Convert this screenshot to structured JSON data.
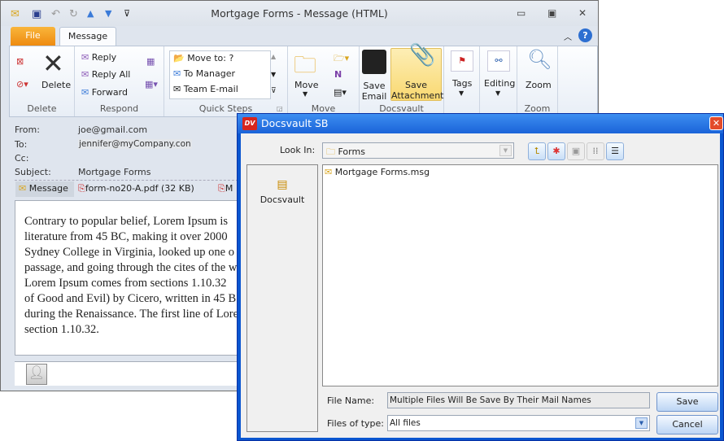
{
  "window": {
    "title": "Mortgage Forms  -  Message (HTML)"
  },
  "qat": {
    "icons": [
      "mail-icon",
      "save-icon",
      "undo-icon",
      "redo-icon",
      "up-arrow-icon",
      "down-arrow-icon",
      "customize-icon"
    ]
  },
  "tabs": {
    "file": "File",
    "message": "Message"
  },
  "ribbon": {
    "delete": {
      "label": "Delete",
      "button": "Delete"
    },
    "respond": {
      "label": "Respond",
      "reply": "Reply",
      "reply_all": "Reply All",
      "forward": "Forward"
    },
    "quick_steps": {
      "label": "Quick Steps",
      "items": [
        "Move to: ?",
        "To Manager",
        "Team E-mail"
      ]
    },
    "move": {
      "label": "Move",
      "button": "Move"
    },
    "docsvault": {
      "label": "Docsvault",
      "save_email": [
        "Save",
        "Email"
      ],
      "save_attachment": [
        "Save",
        "Attachment"
      ]
    },
    "tags": {
      "button": "Tags"
    },
    "editing": {
      "button": "Editing"
    },
    "zoom": {
      "label": "Zoom",
      "button": "Zoom"
    }
  },
  "message": {
    "from_label": "From:",
    "from": "joe@gmail.com",
    "to_label": "To:",
    "to": "jennifer@myCompany.con",
    "cc_label": "Cc:",
    "subject_label": "Subject:",
    "subject": "Mortgage Forms",
    "attachments": [
      "Message",
      "form-no20-A.pdf (32 KB)",
      "M"
    ],
    "body_lines": [
      "Contrary to popular belief, Lorem Ipsum is",
      "literature from 45 BC, making it over 2000",
      "Sydney College in Virginia, looked up one o",
      "passage, and going through the cites of the w",
      "Lorem Ipsum comes from sections 1.10.32",
      "of Good and Evil) by Cicero, written in 45 B",
      "during the Renaissance. The first line of Lore",
      "section 1.10.32."
    ]
  },
  "dialog": {
    "logo": "DV",
    "title": "Docsvault SB",
    "look_in_label": "Look In:",
    "look_in_value": "Forms",
    "sidebar_item": "Docsvault",
    "files": [
      "Mortgage Forms.msg"
    ],
    "file_name_label": "File Name:",
    "file_name_value": "Multiple Files Will Be Save By Their Mail Names",
    "file_type_label": "Files of type:",
    "file_type_value": "All files",
    "save": "Save",
    "cancel": "Cancel"
  }
}
